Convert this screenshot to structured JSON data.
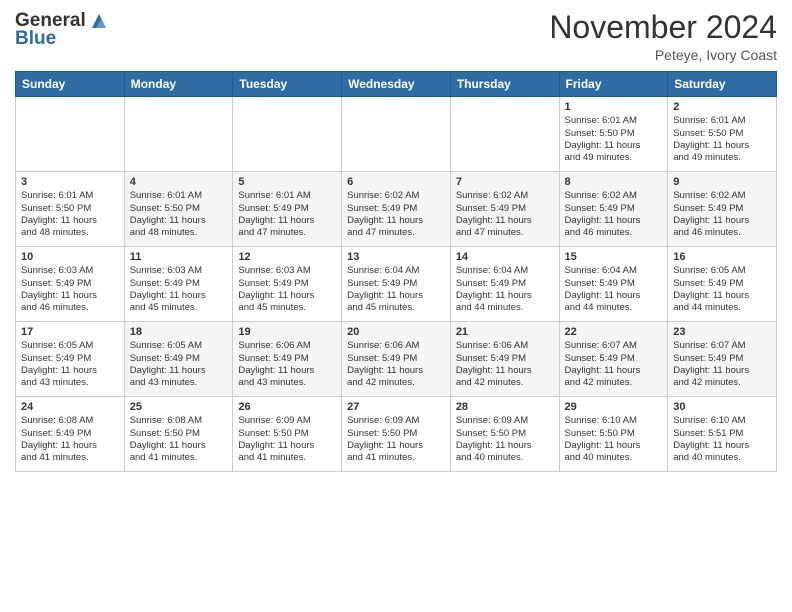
{
  "header": {
    "logo_line1": "General",
    "logo_line2": "Blue",
    "month": "November 2024",
    "location": "Peteye, Ivory Coast"
  },
  "weekdays": [
    "Sunday",
    "Monday",
    "Tuesday",
    "Wednesday",
    "Thursday",
    "Friday",
    "Saturday"
  ],
  "weeks": [
    [
      {
        "day": "",
        "info": ""
      },
      {
        "day": "",
        "info": ""
      },
      {
        "day": "",
        "info": ""
      },
      {
        "day": "",
        "info": ""
      },
      {
        "day": "",
        "info": ""
      },
      {
        "day": "1",
        "info": "Sunrise: 6:01 AM\nSunset: 5:50 PM\nDaylight: 11 hours\nand 49 minutes."
      },
      {
        "day": "2",
        "info": "Sunrise: 6:01 AM\nSunset: 5:50 PM\nDaylight: 11 hours\nand 49 minutes."
      }
    ],
    [
      {
        "day": "3",
        "info": "Sunrise: 6:01 AM\nSunset: 5:50 PM\nDaylight: 11 hours\nand 48 minutes."
      },
      {
        "day": "4",
        "info": "Sunrise: 6:01 AM\nSunset: 5:50 PM\nDaylight: 11 hours\nand 48 minutes."
      },
      {
        "day": "5",
        "info": "Sunrise: 6:01 AM\nSunset: 5:49 PM\nDaylight: 11 hours\nand 47 minutes."
      },
      {
        "day": "6",
        "info": "Sunrise: 6:02 AM\nSunset: 5:49 PM\nDaylight: 11 hours\nand 47 minutes."
      },
      {
        "day": "7",
        "info": "Sunrise: 6:02 AM\nSunset: 5:49 PM\nDaylight: 11 hours\nand 47 minutes."
      },
      {
        "day": "8",
        "info": "Sunrise: 6:02 AM\nSunset: 5:49 PM\nDaylight: 11 hours\nand 46 minutes."
      },
      {
        "day": "9",
        "info": "Sunrise: 6:02 AM\nSunset: 5:49 PM\nDaylight: 11 hours\nand 46 minutes."
      }
    ],
    [
      {
        "day": "10",
        "info": "Sunrise: 6:03 AM\nSunset: 5:49 PM\nDaylight: 11 hours\nand 46 minutes."
      },
      {
        "day": "11",
        "info": "Sunrise: 6:03 AM\nSunset: 5:49 PM\nDaylight: 11 hours\nand 45 minutes."
      },
      {
        "day": "12",
        "info": "Sunrise: 6:03 AM\nSunset: 5:49 PM\nDaylight: 11 hours\nand 45 minutes."
      },
      {
        "day": "13",
        "info": "Sunrise: 6:04 AM\nSunset: 5:49 PM\nDaylight: 11 hours\nand 45 minutes."
      },
      {
        "day": "14",
        "info": "Sunrise: 6:04 AM\nSunset: 5:49 PM\nDaylight: 11 hours\nand 44 minutes."
      },
      {
        "day": "15",
        "info": "Sunrise: 6:04 AM\nSunset: 5:49 PM\nDaylight: 11 hours\nand 44 minutes."
      },
      {
        "day": "16",
        "info": "Sunrise: 6:05 AM\nSunset: 5:49 PM\nDaylight: 11 hours\nand 44 minutes."
      }
    ],
    [
      {
        "day": "17",
        "info": "Sunrise: 6:05 AM\nSunset: 5:49 PM\nDaylight: 11 hours\nand 43 minutes."
      },
      {
        "day": "18",
        "info": "Sunrise: 6:05 AM\nSunset: 5:49 PM\nDaylight: 11 hours\nand 43 minutes."
      },
      {
        "day": "19",
        "info": "Sunrise: 6:06 AM\nSunset: 5:49 PM\nDaylight: 11 hours\nand 43 minutes."
      },
      {
        "day": "20",
        "info": "Sunrise: 6:06 AM\nSunset: 5:49 PM\nDaylight: 11 hours\nand 42 minutes."
      },
      {
        "day": "21",
        "info": "Sunrise: 6:06 AM\nSunset: 5:49 PM\nDaylight: 11 hours\nand 42 minutes."
      },
      {
        "day": "22",
        "info": "Sunrise: 6:07 AM\nSunset: 5:49 PM\nDaylight: 11 hours\nand 42 minutes."
      },
      {
        "day": "23",
        "info": "Sunrise: 6:07 AM\nSunset: 5:49 PM\nDaylight: 11 hours\nand 42 minutes."
      }
    ],
    [
      {
        "day": "24",
        "info": "Sunrise: 6:08 AM\nSunset: 5:49 PM\nDaylight: 11 hours\nand 41 minutes."
      },
      {
        "day": "25",
        "info": "Sunrise: 6:08 AM\nSunset: 5:50 PM\nDaylight: 11 hours\nand 41 minutes."
      },
      {
        "day": "26",
        "info": "Sunrise: 6:09 AM\nSunset: 5:50 PM\nDaylight: 11 hours\nand 41 minutes."
      },
      {
        "day": "27",
        "info": "Sunrise: 6:09 AM\nSunset: 5:50 PM\nDaylight: 11 hours\nand 41 minutes."
      },
      {
        "day": "28",
        "info": "Sunrise: 6:09 AM\nSunset: 5:50 PM\nDaylight: 11 hours\nand 40 minutes."
      },
      {
        "day": "29",
        "info": "Sunrise: 6:10 AM\nSunset: 5:50 PM\nDaylight: 11 hours\nand 40 minutes."
      },
      {
        "day": "30",
        "info": "Sunrise: 6:10 AM\nSunset: 5:51 PM\nDaylight: 11 hours\nand 40 minutes."
      }
    ]
  ]
}
